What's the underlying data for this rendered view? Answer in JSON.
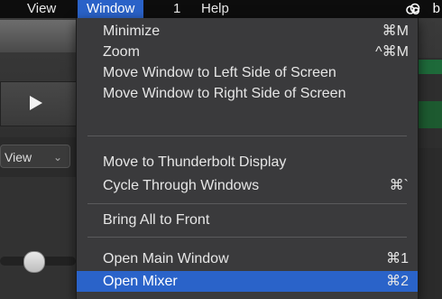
{
  "menubar": {
    "items": [
      {
        "label": "View"
      },
      {
        "label": "Window",
        "active": true
      },
      {
        "label": "1"
      },
      {
        "label": "Help"
      }
    ],
    "right_icon": "creative-cloud-icon",
    "right_partial_text": "b"
  },
  "background": {
    "view_select": "View",
    "play_icon": "play-icon"
  },
  "window_menu": {
    "items": [
      {
        "label": "Minimize",
        "shortcut": "⌘M"
      },
      {
        "label": "Zoom",
        "shortcut": "^⌘M"
      },
      {
        "label": "Move Window to Left Side of Screen",
        "shortcut": ""
      },
      {
        "label": "Move Window to Right Side of Screen",
        "shortcut": ""
      },
      {
        "label": "Move to Thunderbolt Display",
        "shortcut": ""
      },
      {
        "label": "Cycle Through Windows",
        "shortcut": "⌘`"
      },
      {
        "label": "Bring All to Front",
        "shortcut": ""
      },
      {
        "label": "Open Main Window",
        "shortcut": "⌘1"
      },
      {
        "label": "Open Mixer",
        "shortcut": "⌘2",
        "highlighted": true
      }
    ]
  },
  "colors": {
    "highlight": "#2a63c9",
    "menu_bg": "#3a3a3c",
    "menubar_bg": "#0d0d0d"
  }
}
